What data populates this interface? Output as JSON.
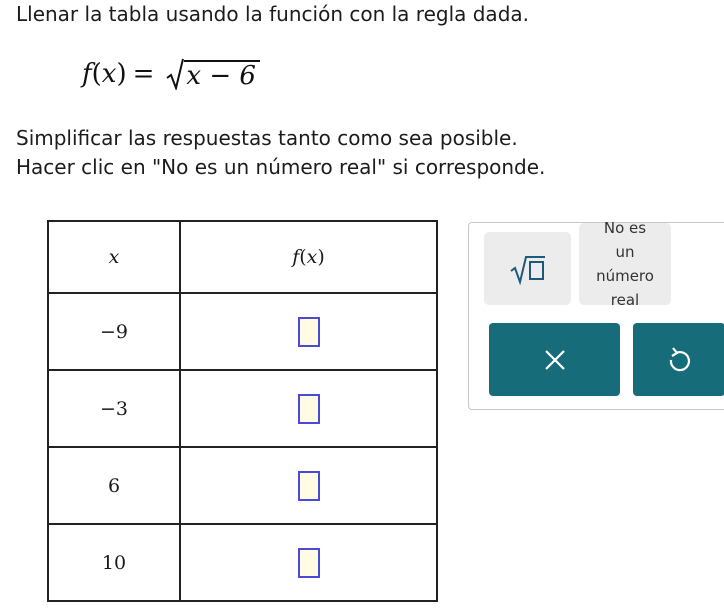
{
  "instructions": {
    "line1": "Llenar la tabla usando la función con la regla dada.",
    "line2": "Simplificar las respuestas tanto como sea posible.",
    "line3": "Hacer clic en \"No es un número real\" si corresponde."
  },
  "formula": {
    "fname": "f",
    "open_paren": "(",
    "var": "x",
    "close_paren": ")",
    "equals": "=",
    "radicand": "x − 6"
  },
  "table": {
    "headers": {
      "x": "x",
      "fx_name": "f",
      "fx_var": "x"
    },
    "rows": [
      {
        "x": "−9",
        "fx": ""
      },
      {
        "x": "−3",
        "fx": ""
      },
      {
        "x": "6",
        "fx": ""
      },
      {
        "x": "10",
        "fx": ""
      }
    ]
  },
  "keypad": {
    "not_real": {
      "line1": "No es",
      "line2": "un",
      "line3": "número",
      "line4": "real"
    },
    "sqrt_icon": "sqrt-box-icon",
    "clear_icon": "x-icon",
    "undo_icon": "undo-icon",
    "colors": {
      "action_bg": "#176c7a",
      "key_bg": "#ececec",
      "answer_box_border": "#4a4ad6",
      "answer_box_fill": "#fffbe4"
    }
  }
}
